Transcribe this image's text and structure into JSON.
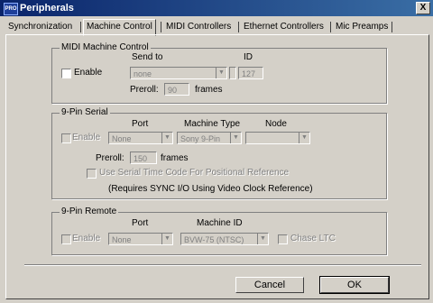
{
  "window": {
    "title": "Peripherals",
    "app_icon_text": "PRO",
    "close_label": "X"
  },
  "tabs": [
    "Synchronization",
    "Machine Control",
    "MIDI Controllers",
    "Ethernet Controllers",
    "Mic Preamps"
  ],
  "midi_mc": {
    "title": "MIDI Machine Control",
    "enable_label": "Enable",
    "send_to_label": "Send to",
    "id_label": "ID",
    "send_to_value": "none",
    "id_value": "127",
    "preroll_label": "Preroll:",
    "preroll_value": "90",
    "frames_label": "frames"
  },
  "serial": {
    "title": "9-Pin Serial",
    "enable_label": "Enable",
    "port_label": "Port",
    "machine_type_label": "Machine Type",
    "node_label": "Node",
    "port_value": "None",
    "machine_type_value": "Sony 9-Pin",
    "node_value": "",
    "preroll_label": "Preroll:",
    "preroll_value": "150",
    "frames_label": "frames",
    "use_serial_tc_label": "Use Serial Time Code For Positional Reference",
    "note": "(Requires SYNC I/O Using Video Clock Reference)"
  },
  "remote": {
    "title": "9-Pin Remote",
    "enable_label": "Enable",
    "port_label": "Port",
    "machine_id_label": "Machine ID",
    "port_value": "None",
    "machine_id_value": "BVW-75 (NTSC)",
    "chase_ltc_label": "Chase LTC"
  },
  "buttons": {
    "cancel": "Cancel",
    "ok": "OK"
  }
}
